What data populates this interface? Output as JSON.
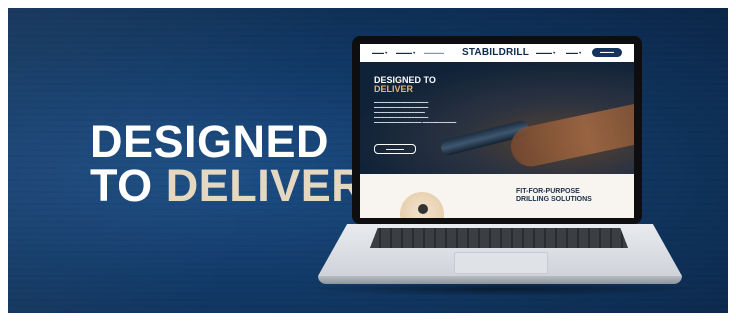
{
  "banner": {
    "headline_line1": "DESIGNED",
    "headline_line2_plain": "TO ",
    "headline_line2_accent": "DELIVER"
  },
  "website": {
    "nav": {
      "brand": "STABILDRILL"
    },
    "hero": {
      "title_line1": "DESIGNED TO",
      "title_accent": "DELIVER"
    },
    "section": {
      "title_line1": "FIT-FOR-PURPOSE",
      "title_line2": "DRILLING SOLUTIONS"
    }
  },
  "colors": {
    "background": "#123a68",
    "accent_text": "#e6d8c0",
    "hero_accent": "#e3b57c",
    "brand_navy": "#0e2a4d"
  },
  "icons": [
    "laptop",
    "drill-bit"
  ]
}
